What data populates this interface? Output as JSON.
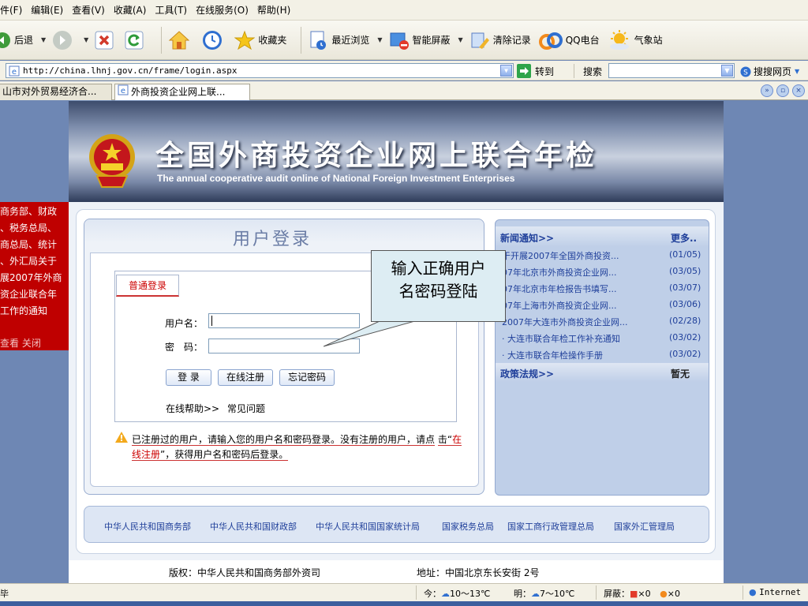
{
  "menubar": {
    "items": [
      "件(F)",
      "编辑(E)",
      "查看(V)",
      "收藏(A)",
      "工具(T)",
      "在线服务(O)",
      "帮助(H)"
    ]
  },
  "toolbar": {
    "back": "后退",
    "favorites": "收藏夹",
    "recent": "最近浏览",
    "smart_block": "智能屏蔽",
    "clear_history": "清除记录",
    "qq_radio": "QQ电台",
    "weather": "气象站"
  },
  "address": {
    "url": "http://china.lhnj.gov.cn/frame/login.aspx",
    "go_label": "转到",
    "search_label": "搜索",
    "search_value": "",
    "sogou_label": "搜搜网页"
  },
  "tabs": [
    {
      "label": "山市对外贸易经济合..."
    },
    {
      "label": "外商投资企业网上联..."
    }
  ],
  "banner": {
    "title_cn": "全国外商投资企业网上联合年检",
    "title_en": "The annual cooperative audit online of National Foreign Investment Enterprises"
  },
  "left_notice": {
    "lines": [
      "商务部、财政",
      "、税务总局、",
      "商总局、统计",
      "、外汇局关于",
      "展2007年外商",
      "资企业联合年",
      "工作的通知"
    ],
    "actions": "查看 关闭"
  },
  "login": {
    "title": "用户登录",
    "tab": "普通登录",
    "username_label": "用户名：",
    "username_value": "",
    "password_label": "密　码：",
    "password_value": "",
    "login_button": "登 录",
    "register_button": "在线注册",
    "forgot_button": "忘记密码",
    "help_text": "在线帮助>>",
    "faq": "常见问题",
    "notice_part1": "已注册过的用户，请输入您的用户名和密码登录。没有注册的用户，请点",
    "notice_part2_prefix": "击“",
    "notice_link": "在线注册",
    "notice_part2_suffix": "”，获得用户名和密码后登录。"
  },
  "callout": {
    "line1": "输入正确用户",
    "line2": "名密码登陆"
  },
  "news": {
    "heading": "新闻通知>>",
    "more": "更多..",
    "items": [
      {
        "title": "于开展2007年全国外商投资...",
        "date": "(01/05)"
      },
      {
        "title": "07年北京市外商投资企业网...",
        "date": "(03/05)"
      },
      {
        "title": "07年北京市年检报告书填写...",
        "date": "(03/07)"
      },
      {
        "title": "07年上海市外商投资企业网...",
        "date": "(03/06)"
      },
      {
        "title": "2007年大连市外商投资企业网...",
        "date": "(02/28)"
      },
      {
        "title": "· 大连市联合年检工作补充通知",
        "date": "(03/02)"
      },
      {
        "title": "· 大连市联合年检操作手册",
        "date": "(03/02)"
      }
    ],
    "policy_heading": "政策法规>>",
    "policy_none": "暂无"
  },
  "links": [
    "中华人民共和国商务部",
    "中华人民共和国财政部",
    "中华人民共和国国家统计局",
    "国家税务总局",
    "国家工商行政管理总局",
    "国家外汇管理局"
  ],
  "footer": {
    "copyright": "版权：中华人民共和国商务部外资司",
    "address": "地址：中国北京东长安街 2号"
  },
  "statusbar": {
    "status": "毕",
    "today": "今：",
    "today_temp": "10～13℃",
    "tomorrow": "明：",
    "tomorrow_temp": "7～10℃",
    "blocked": "屏蔽：",
    "count1": "×0",
    "count2": "×0",
    "zone": "Internet"
  },
  "colors": {
    "page_bg": "#6e87b4",
    "notice_red": "#bf0000",
    "link_blue": "#1f3f9a"
  }
}
